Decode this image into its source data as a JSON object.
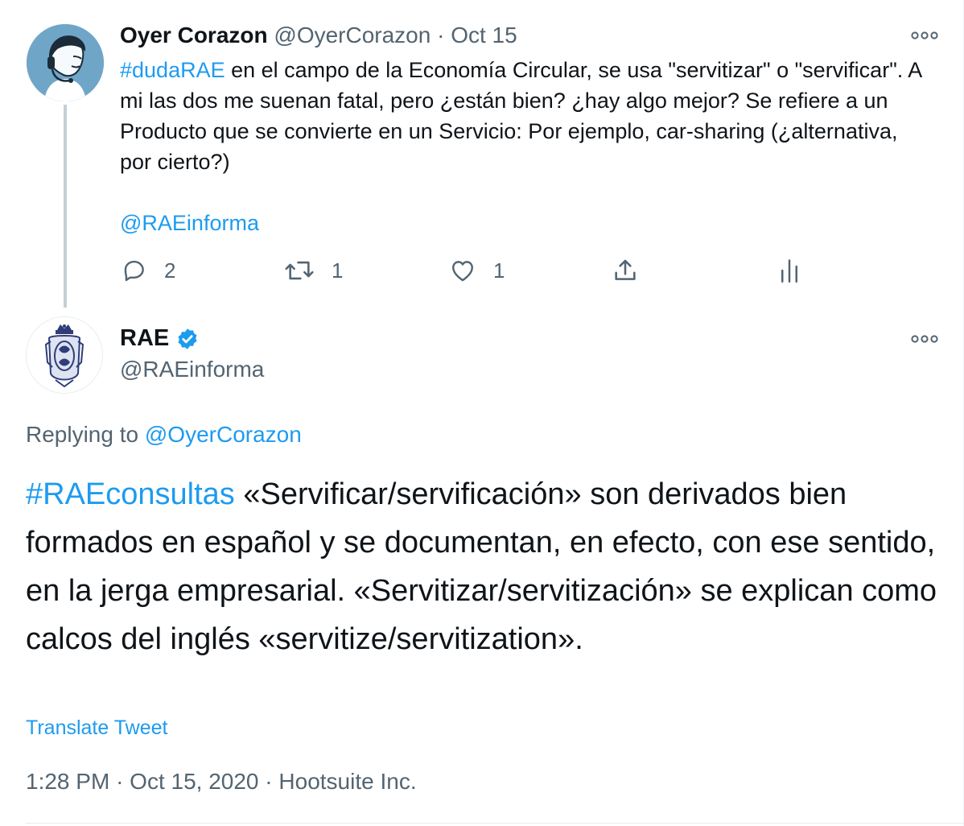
{
  "tweet1": {
    "name": "Oyer Corazon",
    "handle": "@OyerCorazon",
    "separator": "·",
    "date": "Oct 15",
    "hashtag": "#dudaRAE",
    "text": " en el campo de la Economía Circular, se usa \"servitizar\" o \"servificar\". A mi las dos me suenan fatal, pero ¿están bien? ¿hay algo mejor? Se refiere a un Producto que se convierte en un Servicio: Por ejemplo, car-sharing (¿alternativa, por cierto?)",
    "mention": "@RAEinforma",
    "reply_count": "2",
    "retweet_count": "1",
    "like_count": "1"
  },
  "tweet2": {
    "name": "RAE",
    "handle": "@RAEinforma",
    "replying_prefix": "Replying to ",
    "replying_to": "@OyerCorazon",
    "hashtag": "#RAEconsultas",
    "text": " «Servificar/servificación» son derivados bien formados en español y se documentan, en efecto, con ese sentido, en la jerga empresarial. «Servitizar/servitización» se explican como calcos del inglés «servitize/servitization».",
    "translate_label": "Translate Tweet",
    "time": "1:28 PM",
    "separator": "·",
    "date": "Oct 15, 2020",
    "source": "Hootsuite Inc."
  },
  "colors": {
    "link": "#1d9bf0",
    "muted": "#536471",
    "text": "#0f1419",
    "thread_line": "#c4cfd6"
  },
  "icons": {
    "avatar_oyer": "person-with-headset-avatar",
    "avatar_rae": "coat-of-arms-avatar",
    "more": "more-options-icon",
    "reply": "reply-icon",
    "retweet": "retweet-icon",
    "like": "heart-icon",
    "share": "share-icon",
    "stats": "stats-icon",
    "verified": "verified-badge-icon"
  }
}
